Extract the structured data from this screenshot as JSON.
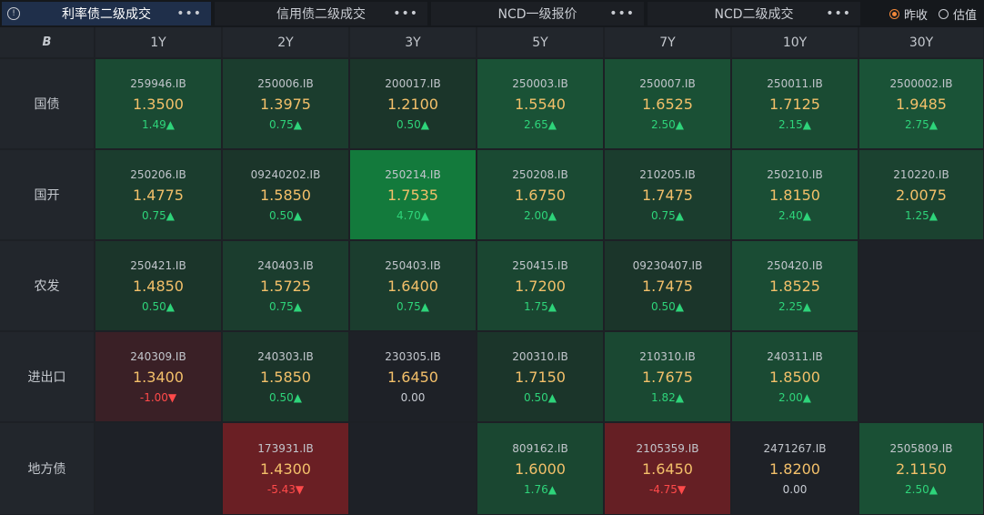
{
  "tabs": [
    {
      "label": "利率债二级成交",
      "active": true
    },
    {
      "label": "信用债二级成交",
      "active": false
    },
    {
      "label": "NCD一级报价",
      "active": false
    },
    {
      "label": "NCD二级成交",
      "active": false
    }
  ],
  "more_label": "•••",
  "info_glyph": "!",
  "radio": [
    {
      "label": "昨收",
      "checked": true
    },
    {
      "label": "估值",
      "checked": false
    }
  ],
  "corner_glyph": "B",
  "columns": [
    "1Y",
    "2Y",
    "3Y",
    "5Y",
    "7Y",
    "10Y",
    "30Y"
  ],
  "rows": [
    {
      "label": "国债",
      "cells": [
        {
          "code": "259946.IB",
          "rate": "1.3500",
          "chg": "1.49▲",
          "dir": "up",
          "bg": "#1a4a33"
        },
        {
          "code": "250006.IB",
          "rate": "1.3975",
          "chg": "0.75▲",
          "dir": "up",
          "bg": "#1b3d2e"
        },
        {
          "code": "200017.IB",
          "rate": "1.2100",
          "chg": "0.50▲",
          "dir": "up",
          "bg": "#1b352a"
        },
        {
          "code": "250003.IB",
          "rate": "1.5540",
          "chg": "2.65▲",
          "dir": "up",
          "bg": "#1a5236"
        },
        {
          "code": "250007.IB",
          "rate": "1.6525",
          "chg": "2.50▲",
          "dir": "up",
          "bg": "#1a5035"
        },
        {
          "code": "250011.IB",
          "rate": "1.7125",
          "chg": "2.15▲",
          "dir": "up",
          "bg": "#1a4b33"
        },
        {
          "code": "2500002.IB",
          "rate": "1.9485",
          "chg": "2.75▲",
          "dir": "up",
          "bg": "#1a5337"
        }
      ]
    },
    {
      "label": "国开",
      "cells": [
        {
          "code": "250206.IB",
          "rate": "1.4775",
          "chg": "0.75▲",
          "dir": "up",
          "bg": "#1b3d2e"
        },
        {
          "code": "09240202.IB",
          "rate": "1.5850",
          "chg": "0.50▲",
          "dir": "up",
          "bg": "#1b352a"
        },
        {
          "code": "250214.IB",
          "rate": "1.7535",
          "chg": "4.70▲",
          "dir": "up",
          "bg": "#137a3c"
        },
        {
          "code": "250208.IB",
          "rate": "1.6750",
          "chg": "2.00▲",
          "dir": "up",
          "bg": "#1a4a33"
        },
        {
          "code": "210205.IB",
          "rate": "1.7475",
          "chg": "0.75▲",
          "dir": "up",
          "bg": "#1b3d2e"
        },
        {
          "code": "250210.IB",
          "rate": "1.8150",
          "chg": "2.40▲",
          "dir": "up",
          "bg": "#1a4e35"
        },
        {
          "code": "210220.IB",
          "rate": "2.0075",
          "chg": "1.25▲",
          "dir": "up",
          "bg": "#1b4230"
        }
      ]
    },
    {
      "label": "农发",
      "cells": [
        {
          "code": "250421.IB",
          "rate": "1.4850",
          "chg": "0.50▲",
          "dir": "up",
          "bg": "#1b352a"
        },
        {
          "code": "240403.IB",
          "rate": "1.5725",
          "chg": "0.75▲",
          "dir": "up",
          "bg": "#1b3d2e"
        },
        {
          "code": "250403.IB",
          "rate": "1.6400",
          "chg": "0.75▲",
          "dir": "up",
          "bg": "#1b3d2e"
        },
        {
          "code": "250415.IB",
          "rate": "1.7200",
          "chg": "1.75▲",
          "dir": "up",
          "bg": "#1a4631"
        },
        {
          "code": "09230407.IB",
          "rate": "1.7475",
          "chg": "0.50▲",
          "dir": "up",
          "bg": "#1b352a"
        },
        {
          "code": "250420.IB",
          "rate": "1.8525",
          "chg": "2.25▲",
          "dir": "up",
          "bg": "#1a4c34"
        },
        {
          "code": "",
          "rate": "",
          "chg": "",
          "dir": "flat",
          "bg": "#1e2127"
        }
      ]
    },
    {
      "label": "进出口",
      "cells": [
        {
          "code": "240309.IB",
          "rate": "1.3400",
          "chg": "-1.00▼",
          "dir": "down",
          "bg": "#3a2026"
        },
        {
          "code": "240303.IB",
          "rate": "1.5850",
          "chg": "0.50▲",
          "dir": "up",
          "bg": "#1b352a"
        },
        {
          "code": "230305.IB",
          "rate": "1.6450",
          "chg": "0.00",
          "dir": "flat",
          "bg": "#1e2127"
        },
        {
          "code": "200310.IB",
          "rate": "1.7150",
          "chg": "0.50▲",
          "dir": "up",
          "bg": "#1b352a"
        },
        {
          "code": "210310.IB",
          "rate": "1.7675",
          "chg": "1.82▲",
          "dir": "up",
          "bg": "#1a4832"
        },
        {
          "code": "240311.IB",
          "rate": "1.8500",
          "chg": "2.00▲",
          "dir": "up",
          "bg": "#1a4a33"
        },
        {
          "code": "",
          "rate": "",
          "chg": "",
          "dir": "flat",
          "bg": "#1e2127"
        }
      ]
    },
    {
      "label": "地方债",
      "cells": [
        {
          "code": "",
          "rate": "",
          "chg": "",
          "dir": "flat",
          "bg": "#1e2127"
        },
        {
          "code": "173931.IB",
          "rate": "1.4300",
          "chg": "-5.43▼",
          "dir": "down",
          "bg": "#6a1f24"
        },
        {
          "code": "",
          "rate": "",
          "chg": "",
          "dir": "flat",
          "bg": "#1e2127"
        },
        {
          "code": "809162.IB",
          "rate": "1.6000",
          "chg": "1.76▲",
          "dir": "up",
          "bg": "#1a4731"
        },
        {
          "code": "2105359.IB",
          "rate": "1.6450",
          "chg": "-4.75▼",
          "dir": "down",
          "bg": "#651f24"
        },
        {
          "code": "2471267.IB",
          "rate": "1.8200",
          "chg": "0.00",
          "dir": "flat",
          "bg": "#1e2127"
        },
        {
          "code": "2505809.IB",
          "rate": "2.1150",
          "chg": "2.50▲",
          "dir": "up",
          "bg": "#1a5035"
        }
      ]
    }
  ]
}
